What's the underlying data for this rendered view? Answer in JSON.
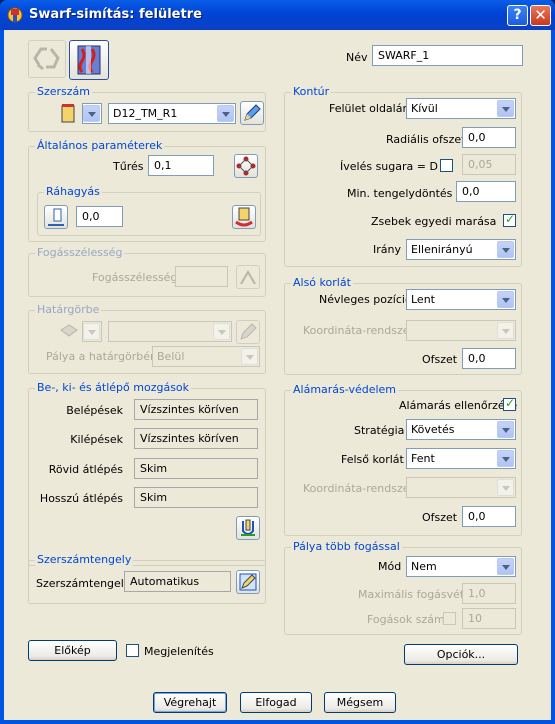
{
  "window": {
    "title": "Swarf-simítás: felületre",
    "help_label": "?",
    "close_label": "✕"
  },
  "nev": {
    "label": "Név",
    "value": "SWARF_1"
  },
  "szerszam": {
    "title": "Szerszám",
    "tool": "D12_TM_R1"
  },
  "altalanos": {
    "title": "Általános paraméterek",
    "tures_label": "Tűrés",
    "tures_value": "0,1"
  },
  "rahagyas": {
    "title": "Ráhagyás",
    "value": "0,0"
  },
  "fogasszelesseg": {
    "title": "Fogásszélesség",
    "label": "Fogásszélesség",
    "value": ""
  },
  "hatargorbe": {
    "title": "Határgörbe",
    "palya_label": "Pálya a határgörbén",
    "palya_value": "Belül",
    "select_value": ""
  },
  "mozgasok": {
    "title": "Be-, ki- és átlépő mozgások",
    "rows": [
      {
        "label": "Belépések",
        "value": "Vízszintes köríven"
      },
      {
        "label": "Kilépések",
        "value": "Vízszintes köríven"
      },
      {
        "label": "Rövid átlépés",
        "value": "Skim"
      },
      {
        "label": "Hosszú átlépés",
        "value": "Skim"
      }
    ]
  },
  "szerszamtengely": {
    "title": "Szerszámtengely",
    "label": "Szerszámtengely",
    "value": "Automatikus"
  },
  "kontur": {
    "title": "Kontúr",
    "feluletoldalan_label": "Felület oldalán",
    "feluletoldalan_value": "Kívül",
    "radialis_label": "Radiális ofszet",
    "radialis_value": "0,0",
    "ivelesi_label": "Ívelés sugara = D x",
    "ivelesi_value": "0,05",
    "min_label": "Min. tengelydöntés",
    "min_value": "0,0",
    "zsebek_label": "Zsebek egyedi marása",
    "irany_label": "Irány",
    "irany_value": "Ellenirányú"
  },
  "also": {
    "title": "Alsó korlát",
    "nevleges_label": "Névleges pozíció",
    "nevleges_value": "Lent",
    "koord_label": "Koordináta-rendszer",
    "koord_value": "",
    "ofszet_label": "Ofszet",
    "ofszet_value": "0,0"
  },
  "alamaras": {
    "title": "Alámarás-védelem",
    "ellenorzes_label": "Alámarás ellenőrzése",
    "strategia_label": "Stratégia",
    "strategia_value": "Követés",
    "felso_label": "Felső korlát",
    "felso_value": "Fent",
    "koord_label": "Koordináta-rendszer",
    "koord_value": "",
    "ofszet_label": "Ofszet",
    "ofszet_value": "0,0"
  },
  "palya": {
    "title": "Pálya több fogással",
    "mod_label": "Mód",
    "mod_value": "Nem",
    "max_label": "Maximális fogásvétel",
    "max_value": "1,0",
    "fogasok_label": "Fogások száma",
    "fogasok_value": "10"
  },
  "bottom": {
    "elokep": "Előkép",
    "megjelenites": "Megjelenítés",
    "opciok": "Opciók...",
    "vegrehajt": "Végrehajt",
    "elfogad": "Elfogad",
    "megsem": "Mégsem"
  }
}
